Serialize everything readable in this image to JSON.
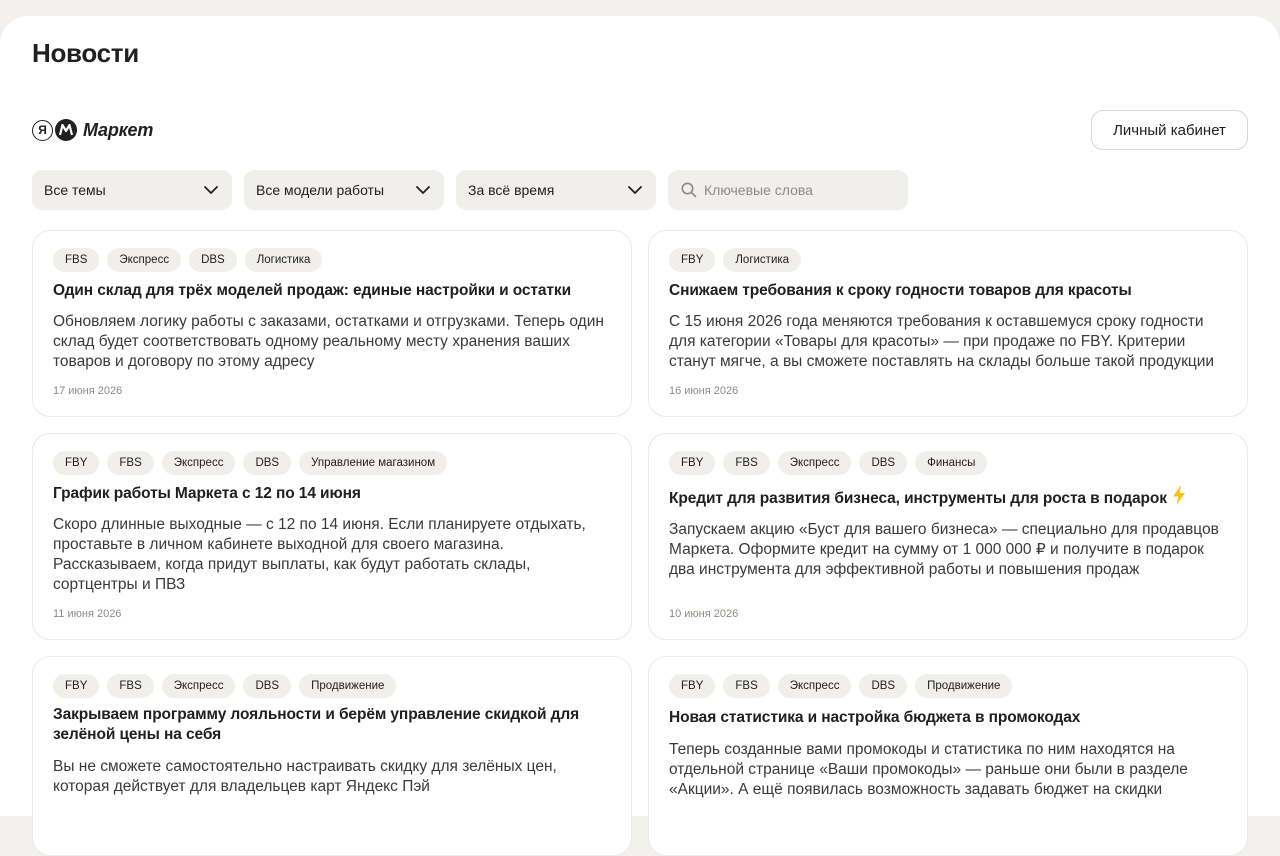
{
  "page": {
    "title": "Новости"
  },
  "logo": {
    "ya_glyph": "Я",
    "brand": "Маркет"
  },
  "header": {
    "cabinet_button": "Личный кабинет"
  },
  "filters": {
    "topics": "Все темы",
    "models": "Все модели работы",
    "period": "За всё время",
    "search_placeholder": "Ключевые слова"
  },
  "colors": {
    "accent_bolt": "#ffc107",
    "chip_bg": "#f0efec",
    "text": "#21201f",
    "muted": "#8d8a85"
  },
  "cards": [
    {
      "tags": [
        "FBS",
        "Экспресс",
        "DBS",
        "Логистика"
      ],
      "title": "Один склад для трёх моделей продаж: единые настройки и остатки",
      "body": "Обновляем логику работы с заказами, остатками и отгрузками. Теперь один склад будет соответствовать одному реальному месту хранения ваших товаров и договору по этому адресу",
      "date": "17 июня 2026"
    },
    {
      "tags": [
        "FBY",
        "Логистика"
      ],
      "title": "Снижаем требования к сроку годности товаров для красоты",
      "body": "С 15 июня 2026 года меняются требования к оставшемуся сроку годности для категории «Товары для красоты» — при продаже по FBY. Критерии станут мягче, а вы сможете поставлять на склады больше такой продукции",
      "date": "16 июня 2026"
    },
    {
      "tags": [
        "FBY",
        "FBS",
        "Экспресс",
        "DBS",
        "Управление магазином"
      ],
      "title": "График работы Маркета с 12 по 14 июня",
      "body": "Скоро длинные выходные — с 12 по 14 июня. Если планируете отдыхать, проставьте в личном кабинете выходной для своего магазина. Рассказываем, когда придут выплаты, как будут работать склады, сортцентры и ПВЗ",
      "date": "11 июня 2026"
    },
    {
      "tags": [
        "FBY",
        "FBS",
        "Экспресс",
        "DBS",
        "Финансы"
      ],
      "title": "Кредит для развития бизнеса, инструменты для роста в подарок",
      "body": "Запускаем акцию «Буст для вашего бизнеса» — специально для продавцов Маркета. Оформите кредит на сумму от 1 000 000 ₽ и получите в подарок два инструмента для эффективной работы и повышения продаж",
      "date": "10 июня 2026",
      "icon": "lightning-icon"
    },
    {
      "tags": [
        "FBY",
        "FBS",
        "Экспресс",
        "DBS",
        "Продвижение"
      ],
      "title": "Закрываем программу лояльности и берём управление скидкой для зелёной цены на себя",
      "body": "Вы не сможете самостоятельно настраивать скидку для зелёных цен, которая действует для владельцев карт Яндекс Пэй"
    },
    {
      "tags": [
        "FBY",
        "FBS",
        "Экспресс",
        "DBS",
        "Продвижение"
      ],
      "title": "Новая статистика и настройка бюджета в промокодах",
      "body": "Теперь созданные вами промокоды и статистика по ним находятся на отдельной странице «Ваши промокоды» — раньше они были в разделе «Акции». А ещё появилась возможность задавать бюджет на скидки"
    }
  ]
}
